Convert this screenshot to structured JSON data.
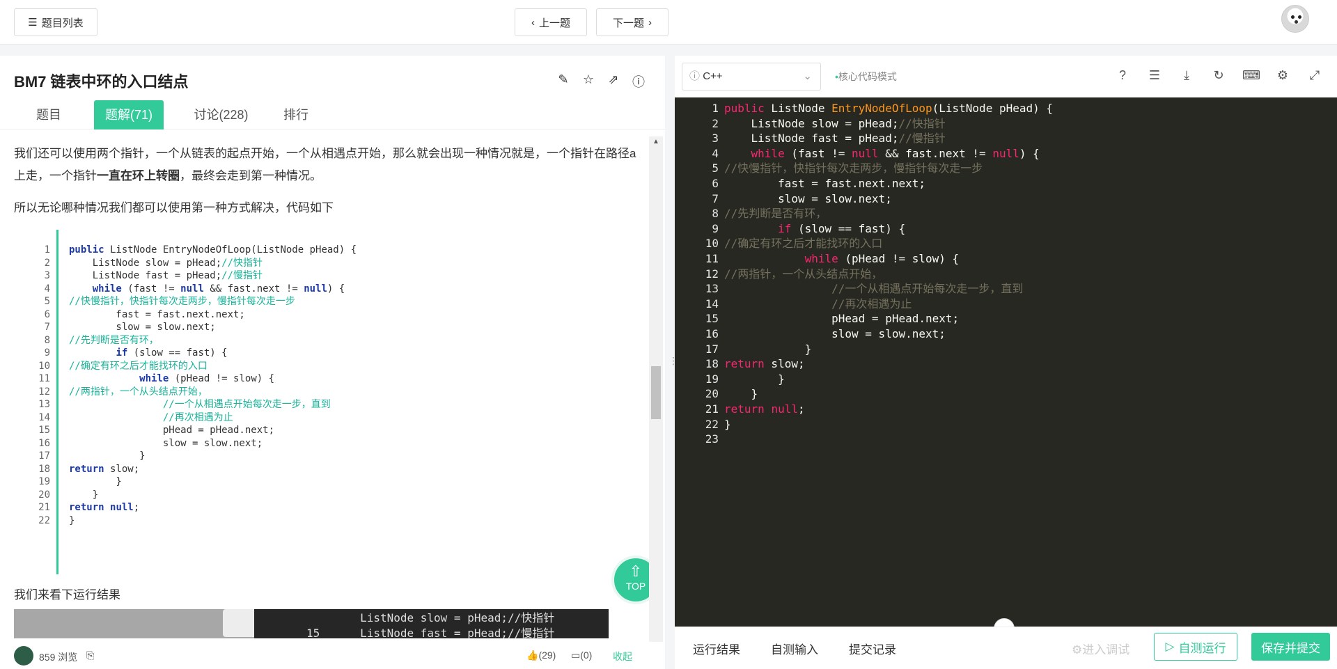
{
  "topbar": {
    "list_label": "题目列表",
    "prev_label": "上一题",
    "next_label": "下一题"
  },
  "problem": {
    "title": "BM7  链表中环的入口结点",
    "tabs": [
      {
        "label": "题目"
      },
      {
        "label": "题解(71)"
      },
      {
        "label": "讨论(228)"
      },
      {
        "label": "排行"
      }
    ]
  },
  "article": {
    "para1_a": "我们还可以使用两个指针，一个从链表的起点开始，一个从相遇点开始，那么就会出现一种情况就是，一个指针在路径a上走，一个指针",
    "para1_bold": "一直在环上转圈",
    "para1_b": "，最终会走到第一种情况。",
    "para2": "所以无论哪种情况我们都可以使用第一种方式解决，代码如下",
    "para3": "我们来看下运行结果",
    "result_code_line": "        ListNode slow = pHead;//快指针",
    "result_code_line2": "15      ListNode fast = pHead;//慢指针",
    "views": "859 浏览",
    "likes": "(29)",
    "comments": "(0)",
    "collapse": "收起",
    "top_label": "TOP"
  },
  "snippet": [
    {
      "n": "1",
      "code": "public ListNode EntryNodeOfLoop(ListNode pHead) {"
    },
    {
      "n": "2",
      "code": "    ListNode slow = pHead;//快指针"
    },
    {
      "n": "3",
      "code": "    ListNode fast = pHead;//慢指针"
    },
    {
      "n": "4",
      "code": "    while (fast != null && fast.next != null) {"
    },
    {
      "n": "5",
      "code": "//快慢指针，快指针每次走两步，慢指针每次走一步"
    },
    {
      "n": "6",
      "code": "        fast = fast.next.next;"
    },
    {
      "n": "7",
      "code": "        slow = slow.next;"
    },
    {
      "n": "8",
      "code": "//先判断是否有环，"
    },
    {
      "n": "9",
      "code": "        if (slow == fast) {"
    },
    {
      "n": "10",
      "code": "//确定有环之后才能找环的入口"
    },
    {
      "n": "11",
      "code": "            while (pHead != slow) {"
    },
    {
      "n": "12",
      "code": "//两指针，一个从头结点开始，"
    },
    {
      "n": "13",
      "code": "                //一个从相遇点开始每次走一步，直到"
    },
    {
      "n": "14",
      "code": "                //再次相遇为止"
    },
    {
      "n": "15",
      "code": "                pHead = pHead.next;"
    },
    {
      "n": "16",
      "code": "                slow = slow.next;"
    },
    {
      "n": "17",
      "code": "            }"
    },
    {
      "n": "18",
      "code": "return slow;"
    },
    {
      "n": "19",
      "code": "        }"
    },
    {
      "n": "20",
      "code": "    }"
    },
    {
      "n": "21",
      "code": "return null;"
    },
    {
      "n": "22",
      "code": "}"
    }
  ],
  "editor": {
    "language": "C++",
    "mode": "核心代码模式",
    "lines": [
      {
        "n": "1",
        "code": "public ListNode EntryNodeOfLoop(ListNode pHead) {"
      },
      {
        "n": "2",
        "code": "    ListNode slow = pHead;//快指针"
      },
      {
        "n": "3",
        "code": "    ListNode fast = pHead;//慢指针"
      },
      {
        "n": "4",
        "code": "    while (fast != null && fast.next != null) {"
      },
      {
        "n": "5",
        "code": "//快慢指针，快指针每次走两步，慢指针每次走一步"
      },
      {
        "n": "6",
        "code": "        fast = fast.next.next;"
      },
      {
        "n": "7",
        "code": "        slow = slow.next;"
      },
      {
        "n": "8",
        "code": "//先判断是否有环，"
      },
      {
        "n": "9",
        "code": "        if (slow == fast) {"
      },
      {
        "n": "10",
        "code": "//确定有环之后才能找环的入口"
      },
      {
        "n": "11",
        "code": "            while (pHead != slow) {"
      },
      {
        "n": "12",
        "code": "//两指针，一个从头结点开始，"
      },
      {
        "n": "13",
        "code": "                //一个从相遇点开始每次走一步，直到"
      },
      {
        "n": "14",
        "code": "                //再次相遇为止"
      },
      {
        "n": "15",
        "code": "                pHead = pHead.next;"
      },
      {
        "n": "16",
        "code": "                slow = slow.next;"
      },
      {
        "n": "17",
        "code": "            }"
      },
      {
        "n": "18",
        "code": "return slow;"
      },
      {
        "n": "19",
        "code": "        }"
      },
      {
        "n": "20",
        "code": "    }"
      },
      {
        "n": "21",
        "code": "return null;"
      },
      {
        "n": "22",
        "code": "}"
      },
      {
        "n": "23",
        "code": ""
      }
    ],
    "bottom_tabs": [
      "运行结果",
      "自测输入",
      "提交记录"
    ],
    "debug_label": "进入调试",
    "run_label": "自测运行",
    "submit_label": "保存并提交"
  },
  "colors": {
    "accent": "#32ca99",
    "editor_bg": "#272822"
  }
}
